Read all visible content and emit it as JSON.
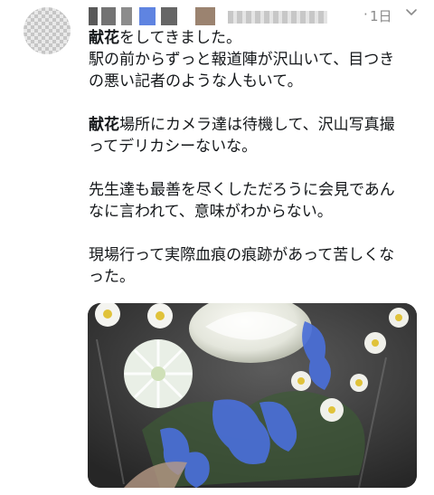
{
  "tweet": {
    "time": "1日",
    "dot": "·",
    "lines": {
      "p1_bold": "献花",
      "p1_rest": "をしてきました。",
      "p1_l2": "駅の前からずっと報道陣が沢山いて、目つき",
      "p1_l3": "の悪い記者のような人もいて。",
      "p2_bold": "献花",
      "p2_rest": "場所にカメラ達は待機して、沢山写真撮",
      "p2_l2": "ってデリカシーないな。",
      "p3_l1": "先生達も最善を尽くしただろうに会見であん",
      "p3_l2": "なに言われて、意味がわからない。",
      "p4_l1": "現場行って実際血痕の痕跡があって苦しくな",
      "p4_l2": "った。"
    },
    "icons": {
      "menu": "chevron-down-icon"
    },
    "colors": {
      "meta": "#8a8a8a",
      "text": "#14171a",
      "flower_blue": "#4a6fd8"
    }
  }
}
